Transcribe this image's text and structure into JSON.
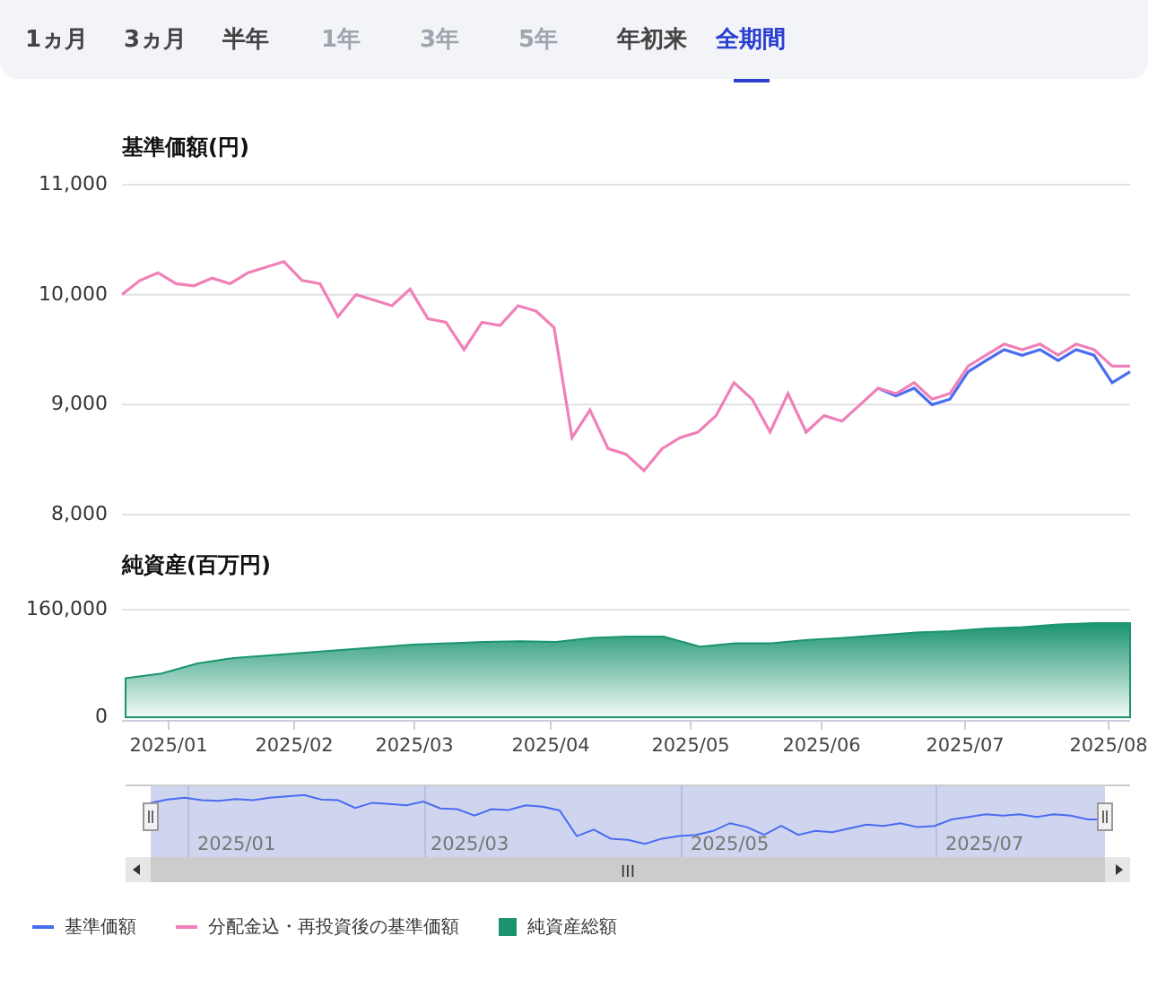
{
  "tabs": [
    {
      "label": "1ヵ月",
      "selected": false,
      "disabled": false
    },
    {
      "label": "3ヵ月",
      "selected": false,
      "disabled": false
    },
    {
      "label": "半年",
      "selected": false,
      "disabled": false
    },
    {
      "label": "1年",
      "selected": false,
      "disabled": true
    },
    {
      "label": "3年",
      "selected": false,
      "disabled": true
    },
    {
      "label": "5年",
      "selected": false,
      "disabled": true
    },
    {
      "label": "年初来",
      "selected": false,
      "disabled": false
    },
    {
      "label": "全期間",
      "selected": true,
      "disabled": false
    }
  ],
  "price_chart": {
    "title": "基準価額(円)",
    "chart_data": {
      "type": "line",
      "ylim": [
        8000,
        11000
      ],
      "yticks": [
        {
          "value": 8000,
          "label": "8,000"
        },
        {
          "value": 9000,
          "label": "9,000"
        },
        {
          "value": 10000,
          "label": "10,000"
        },
        {
          "value": 11000,
          "label": "11,000"
        }
      ],
      "series": [
        {
          "name": "基準価額",
          "color": "#4a6cf0",
          "values": [
            null,
            null,
            null,
            null,
            null,
            null,
            null,
            null,
            null,
            null,
            null,
            null,
            null,
            null,
            null,
            null,
            null,
            null,
            null,
            null,
            null,
            null,
            null,
            null,
            null,
            null,
            null,
            null,
            null,
            null,
            null,
            null,
            null,
            null,
            null,
            null,
            null,
            null,
            null,
            null,
            null,
            null,
            9150,
            9080,
            9150,
            9000,
            9050,
            9300,
            9400,
            9500,
            9450,
            9500,
            9400,
            9500,
            9450,
            9200,
            9300
          ]
        },
        {
          "name": "分配金込・再投資後の基準価額",
          "color": "#f080b8",
          "values": [
            10000,
            10130,
            10200,
            10100,
            10080,
            10150,
            10100,
            10200,
            10250,
            10300,
            10130,
            10100,
            9800,
            10000,
            9950,
            9900,
            10050,
            9780,
            9750,
            9500,
            9750,
            9720,
            9900,
            9850,
            9700,
            8700,
            8950,
            8600,
            8550,
            8400,
            8600,
            8700,
            8750,
            8900,
            9200,
            9050,
            8750,
            9100,
            8750,
            8900,
            8850,
            9000,
            9150,
            9100,
            9200,
            9050,
            9100,
            9350,
            9450,
            9550,
            9500,
            9550,
            9450,
            9550,
            9500,
            9350,
            9350
          ]
        }
      ]
    }
  },
  "assets_chart": {
    "title": "純資産(百万円)",
    "x_labels": [
      "2025/01",
      "2025/02",
      "2025/03",
      "2025/04",
      "2025/05",
      "2025/06",
      "2025/07",
      "2025/08"
    ],
    "chart_data": {
      "type": "area",
      "ylim": [
        0,
        160000
      ],
      "yticks": [
        {
          "value": 0,
          "label": "0"
        },
        {
          "value": 160000,
          "label": "160,000"
        }
      ],
      "series": [
        {
          "name": "純資産総額",
          "color": "#1a9470",
          "values": [
            58000,
            65000,
            80000,
            88000,
            92000,
            96000,
            100000,
            104000,
            108000,
            110000,
            112000,
            113000,
            112000,
            118000,
            120000,
            120000,
            105000,
            110000,
            110000,
            115000,
            118000,
            122000,
            126000,
            128000,
            132000,
            134000,
            138000,
            140000,
            140000
          ]
        }
      ]
    }
  },
  "navigator": {
    "labels": [
      "2025/01",
      "2025/03",
      "2025/05",
      "2025/07"
    ],
    "scroll_grip": "III"
  }
}
